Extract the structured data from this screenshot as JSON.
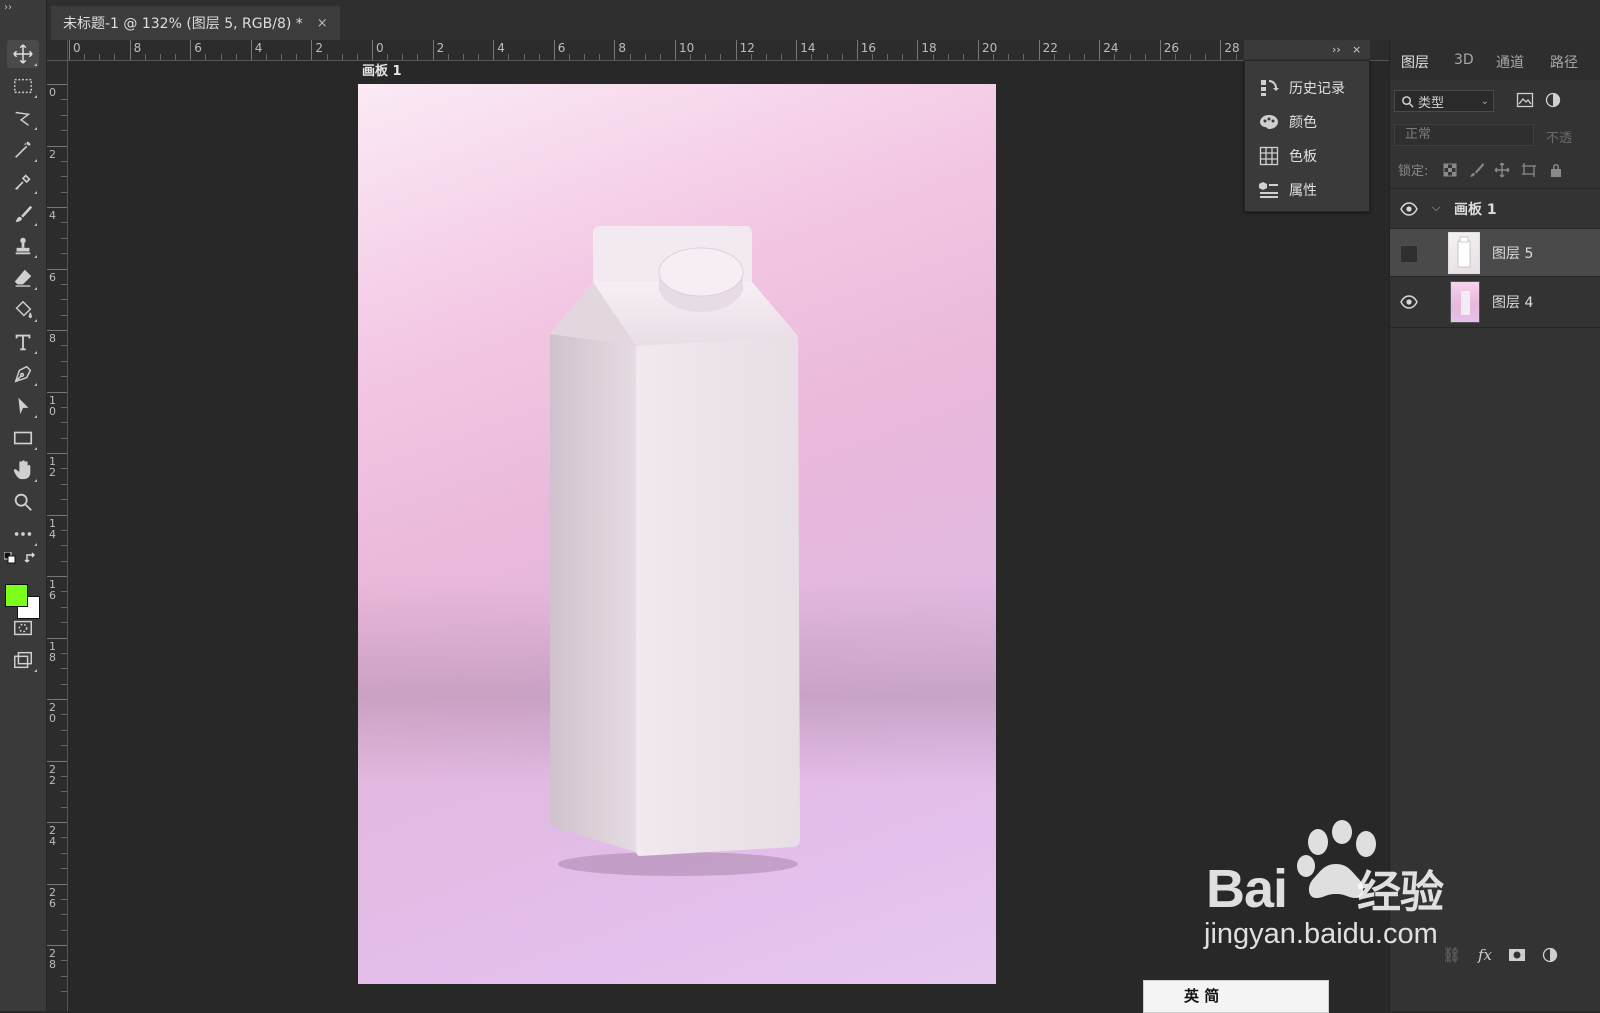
{
  "document_tab": {
    "title": "未标题-1 @ 132% (图层 5, RGB/8) *",
    "close": "×"
  },
  "colors": {
    "foreground": "#7cff1a",
    "background": "#ffffff"
  },
  "toolbar": {
    "tools": [
      "move-tool",
      "rectangular-marquee-tool",
      "lasso-tool",
      "magic-wand-tool",
      "eyedropper-tool",
      "brush-tool",
      "clone-stamp-tool",
      "eraser-tool",
      "paint-bucket-tool",
      "type-tool",
      "pen-tool",
      "path-selection-tool",
      "rectangle-tool",
      "hand-tool",
      "zoom-tool",
      "more-tools"
    ]
  },
  "ruler_top_labels": [
    "0",
    "8",
    "6",
    "4",
    "2",
    "0",
    "2",
    "4",
    "6",
    "8",
    "10",
    "12",
    "14",
    "16",
    "18",
    "20",
    "22",
    "24",
    "26",
    "28"
  ],
  "ruler_left_labels": [
    "0",
    "2",
    "4",
    "6",
    "8",
    "10",
    "12",
    "14",
    "16",
    "18",
    "20",
    "22",
    "24",
    "26",
    "28"
  ],
  "canvas": {
    "artboard_label": "画板 1"
  },
  "floating_panel": {
    "controls": {
      "collapse": "››",
      "close": "×"
    },
    "items": [
      {
        "label": "历史记录",
        "icon": "history-icon"
      },
      {
        "label": "颜色",
        "icon": "color-palette-icon"
      },
      {
        "label": "色板",
        "icon": "swatches-grid-icon"
      },
      {
        "label": "属性",
        "icon": "properties-icon"
      }
    ]
  },
  "layers_panel": {
    "tabs": [
      "图层",
      "3D",
      "通道",
      "路径"
    ],
    "active_tab": "图层",
    "filter": {
      "label": "类型"
    },
    "blend_mode": "正常",
    "opacity_label": "不透",
    "lock_label": "锁定:",
    "layers": [
      {
        "name": "画板 1",
        "type": "artboard",
        "visible": true
      },
      {
        "name": "图层 5",
        "type": "layer",
        "visible": false,
        "selected": true
      },
      {
        "name": "图层 4",
        "type": "layer",
        "visible": true
      }
    ]
  },
  "watermark": {
    "logo": "Bai",
    "logo_tail": "du",
    "logo_cn": "经验",
    "url": "jingyan.baidu.com"
  },
  "ime_bar": {
    "text": "英 简"
  }
}
